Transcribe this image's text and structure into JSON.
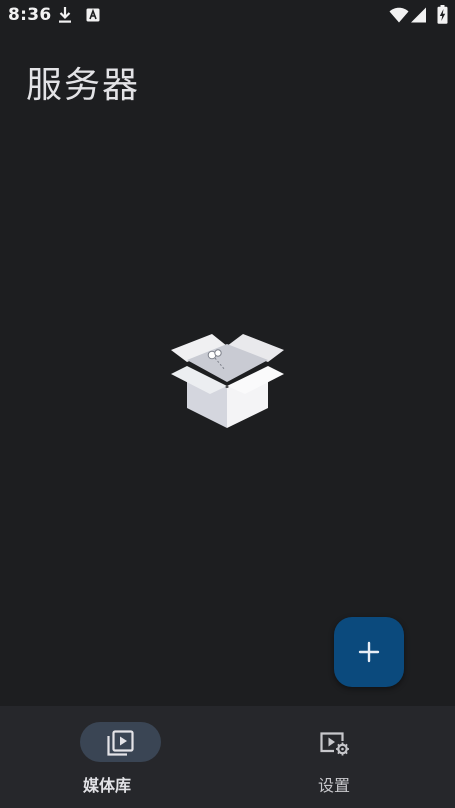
{
  "status_bar": {
    "time": "8:36",
    "icons": [
      "download-icon",
      "notification-a-icon",
      "wifi-icon",
      "signal-icon",
      "battery-charging-icon"
    ]
  },
  "page": {
    "title": "服务器"
  },
  "empty_state": {
    "icon": "empty-box-icon"
  },
  "fab": {
    "icon": "plus-icon",
    "color": "#0b4a7d"
  },
  "bottom_nav": {
    "items": [
      {
        "label": "媒体库",
        "icon": "media-library-icon",
        "selected": true
      },
      {
        "label": "设置",
        "icon": "video-settings-icon",
        "selected": false
      }
    ],
    "indicator_color": "#3a4554"
  }
}
